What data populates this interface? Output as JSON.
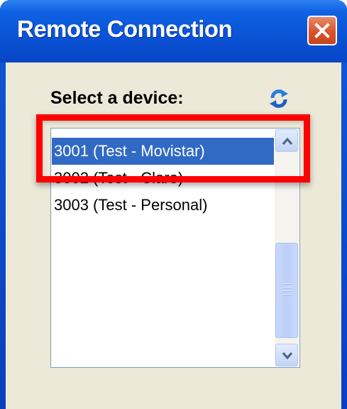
{
  "window": {
    "title": "Remote Connection"
  },
  "dialog": {
    "select_label": "Select a device:"
  },
  "device_list": {
    "items": [
      {
        "label": "3001 (Test - Movistar)",
        "selected": true
      },
      {
        "label": "3002 (Test - Claro)",
        "selected": false
      },
      {
        "label": "3003 (Test - Personal)",
        "selected": false
      }
    ]
  },
  "icons": {
    "close": "close-icon",
    "refresh": "refresh-icon",
    "scroll_up": "chevron-up-icon",
    "scroll_down": "chevron-down-icon"
  },
  "colors": {
    "titlebar": "#0a52d5",
    "client_bg": "#ece9d8",
    "selection": "#316ac5",
    "highlight_box": "#ff0000",
    "close_button": "#d8532d"
  }
}
